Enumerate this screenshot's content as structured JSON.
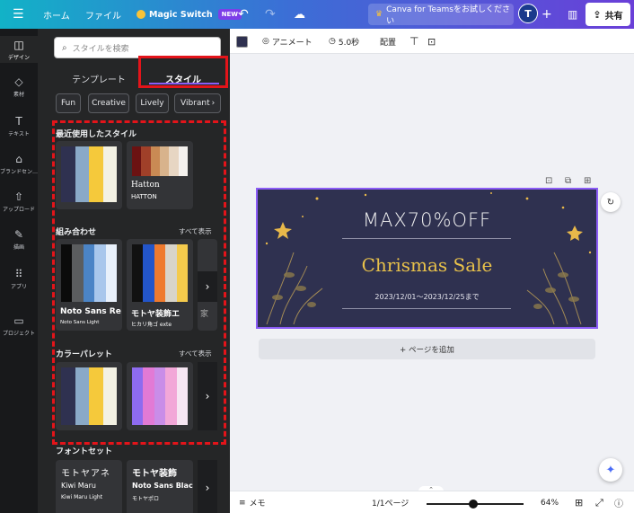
{
  "topbar": {
    "home": "ホーム",
    "file": "ファイル",
    "magic_switch": "Magic Switch",
    "new_badge": "NEW",
    "teams": "Canva for Teamsをお試しください",
    "avatar_initial": "T",
    "share": "共有"
  },
  "rail": {
    "items": [
      {
        "label": "デザイン",
        "icon": "layout-icon"
      },
      {
        "label": "素材",
        "icon": "shapes-icon"
      },
      {
        "label": "テキスト",
        "icon": "text-icon"
      },
      {
        "label": "ブランドセン…",
        "icon": "brand-icon"
      },
      {
        "label": "アップロード",
        "icon": "upload-icon"
      },
      {
        "label": "描画",
        "icon": "draw-icon"
      },
      {
        "label": "アプリ",
        "icon": "apps-icon"
      },
      {
        "label": "プロジェクト",
        "icon": "folder-icon"
      }
    ]
  },
  "panel": {
    "search_placeholder": "スタイルを検索",
    "tabs": [
      "テンプレート",
      "スタイル"
    ],
    "chips": [
      "Fun",
      "Creative",
      "Lively",
      "Vibrant"
    ],
    "recent_title": "最近使用したスタイル",
    "recent_card2_title": "Hatton",
    "recent_card2_sub": "HATTON",
    "combos_title": "組み合わせ",
    "combos_show_all": "すべて表示",
    "combo1_title": "Noto Sans Re",
    "combo1_sub": "Noto Sans Light",
    "combo2_title": "モトヤ装飾エ",
    "combo2_sub": "ヒカリ角ゴ exte",
    "combo3_partial": "家",
    "palettes_title": "カラーパレット",
    "palettes_show_all": "すべて表示",
    "fontsets_title": "フォントセット",
    "font1_title": "モトヤアネ",
    "font1_name": "Kiwi Maru",
    "font1_sub": "Kiwi Maru Light",
    "font2_title": "モトヤ装飾",
    "font2_name": "Noto Sans Black",
    "font2_sub": "モトヤポロ"
  },
  "colors": {
    "recent1": [
      "#2f3150",
      "#8aa9c7",
      "#f5c93b",
      "#f3f1e3"
    ],
    "recent2": [
      "#6b1212",
      "#a04029",
      "#c98a54",
      "#d8b38c",
      "#e7d6c3",
      "#f4f1ee"
    ],
    "combo1": [
      "#0b0b0b",
      "#5b5d5f",
      "#4b84c6",
      "#a9c7ec",
      "#e9f1fb"
    ],
    "combo2": [
      "#111111",
      "#2355c9",
      "#ef7a2d",
      "#d8d4c9",
      "#f4ca4c"
    ],
    "palette1": [
      "#2f3150",
      "#8aa9c7",
      "#f5c93b",
      "#f3f1e3"
    ],
    "palette2": [
      "#8e6bf0",
      "#e27ad5",
      "#c98de8",
      "#f2a7d8",
      "#f6e6f3"
    ]
  },
  "editor": {
    "animate": "アニメート",
    "duration": "5.0秒",
    "position": "配置"
  },
  "design": {
    "title": "MAX70%OFF",
    "sale": "Chrismas Sale",
    "date": "2023/12/01〜2023/12/25まで"
  },
  "canvas": {
    "add_page": "+ ページを追加"
  },
  "bottom": {
    "notes": "メモ",
    "pages": "1/1ページ",
    "zoom": "64%"
  }
}
